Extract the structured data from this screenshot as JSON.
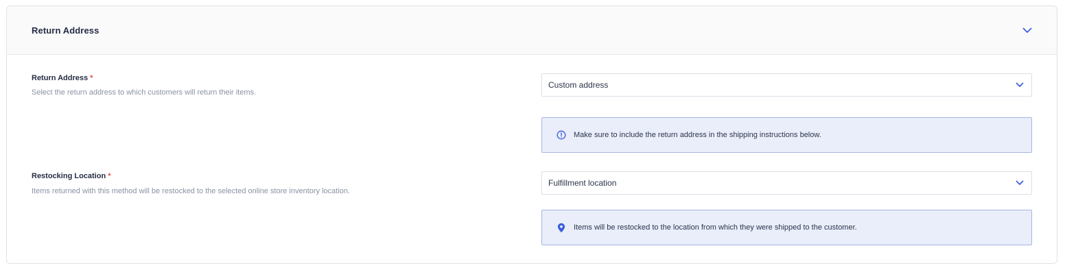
{
  "section": {
    "title": "Return Address",
    "collapse_icon": "chevron-down-icon"
  },
  "return_address": {
    "label": "Return Address",
    "required_mark": "*",
    "description": "Select the return address to which customers will return their items.",
    "selected_value": "Custom address",
    "notice_icon": "info-circle-icon",
    "notice_text": "Make sure to include the return address in the shipping instructions below."
  },
  "restocking_location": {
    "label": "Restocking Location",
    "required_mark": "*",
    "description": "Items returned with this method will be restocked to the selected online store inventory location.",
    "selected_value": "Fulfillment location",
    "notice_icon": "map-pin-icon",
    "notice_text": "Items will be restocked to the location from which they were shipped to the customer."
  },
  "colors": {
    "accent": "#3b5fd9",
    "required": "#e5484d",
    "notice_background": "#eaeefb",
    "notice_border": "#a7b6e3",
    "header_background": "#fafafb"
  }
}
